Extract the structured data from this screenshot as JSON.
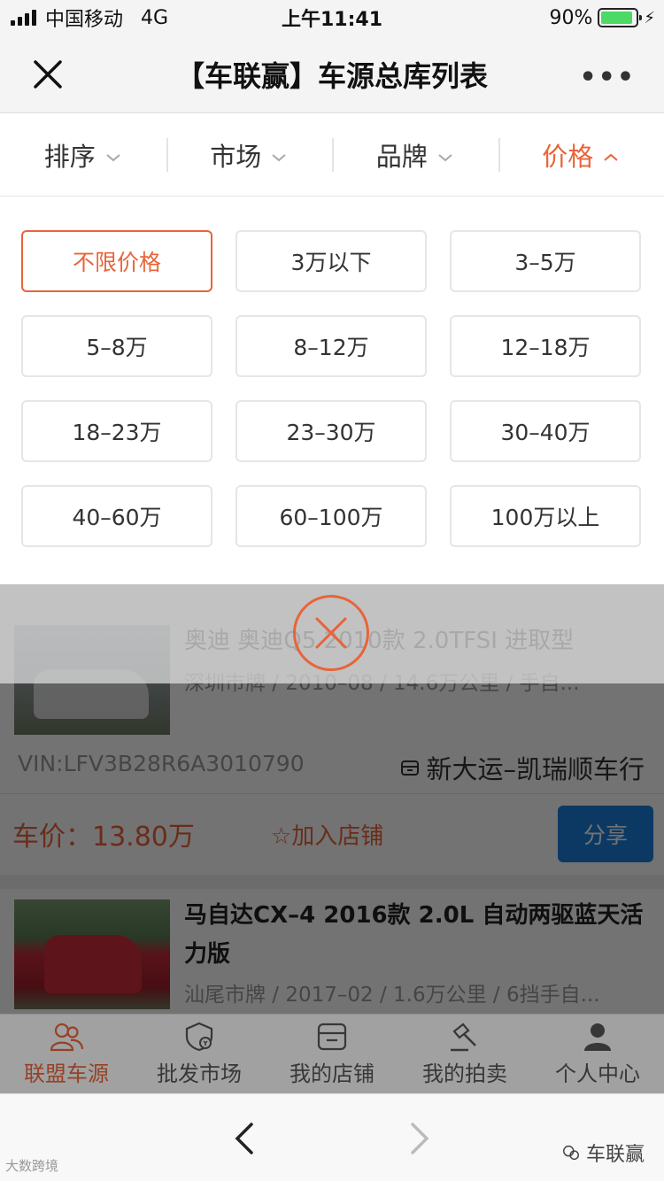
{
  "status_bar": {
    "carrier": "中国移动",
    "network": "4G",
    "time": "上午11:41",
    "battery": "90%",
    "battery_level": 0.9
  },
  "header": {
    "title": "【车联赢】车源总库列表",
    "more": "•••"
  },
  "filters": {
    "tabs": [
      {
        "label": "排序",
        "active": false
      },
      {
        "label": "市场",
        "active": false
      },
      {
        "label": "品牌",
        "active": false
      },
      {
        "label": "价格",
        "active": true
      }
    ]
  },
  "price_options": [
    "不限价格",
    "3万以下",
    "3–5万",
    "5–8万",
    "8–12万",
    "12–18万",
    "18–23万",
    "23–30万",
    "30–40万",
    "40–60万",
    "60–100万",
    "100万以上"
  ],
  "price_selected": "不限价格",
  "listings": [
    {
      "title": "奥迪 奥迪Q5 2010款 2.0TFSI 进取型",
      "meta": "深圳市牌 / 2010–08 / 14.6万公里 / 手自...",
      "vin": "VIN:LFV3B28R6A3010790",
      "dealer": "新大运–凯瑞顺车行",
      "price": "车价：13.80万",
      "fav": "☆加入店铺",
      "share": "分享"
    },
    {
      "title": "马自达CX–4 2016款 2.0L 自动两驱蓝天活力版",
      "meta": "汕尾市牌 / 2017–02 / 1.6万公里 / 6挡手自..."
    }
  ],
  "tab_bar": [
    {
      "label": "联盟车源",
      "icon": "users-icon",
      "active": true
    },
    {
      "label": "批发市场",
      "icon": "wholesale-icon",
      "active": false
    },
    {
      "label": "我的店铺",
      "icon": "store-icon",
      "active": false
    },
    {
      "label": "我的拍卖",
      "icon": "gavel-icon",
      "active": false
    },
    {
      "label": "个人中心",
      "icon": "person-icon",
      "active": false
    }
  ],
  "watermark": {
    "left": "大数跨境",
    "right": "车联赢"
  },
  "colors": {
    "accent": "#e8643a",
    "share_blue": "#1a7fdc",
    "battery_green": "#4cd964"
  }
}
